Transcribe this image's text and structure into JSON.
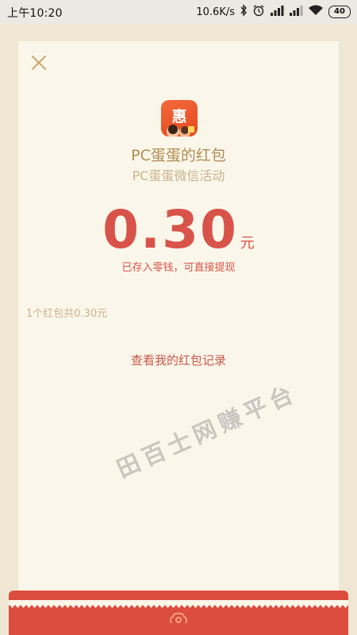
{
  "status_bar": {
    "time": "上午10:20",
    "network_speed": "10.6K/s",
    "battery_level": "40"
  },
  "envelope": {
    "sender_name": "PC蛋蛋的红包",
    "sender_subtitle": "PC蛋蛋微信活动",
    "amount": "0.30",
    "amount_unit": "元",
    "saved_note": "已存入零钱，可直接提现",
    "summary": "1个红包共0.30元",
    "records_link": "查看我的红包记录",
    "app_icon_glyph": "惠"
  },
  "watermark": {
    "text": "田百士网赚平台"
  },
  "colors": {
    "page_background": "#efe6d4",
    "card_background": "#fbf6ea",
    "accent_red": "#d8534a",
    "gold_text": "#b08d53",
    "muted_gold": "#c8b48c",
    "flap_red": "#dc4d3f"
  },
  "icons": {
    "close": "close-icon",
    "bluetooth": "bluetooth-icon",
    "alarm": "alarm-icon",
    "signal": "signal-icon",
    "wifi": "wifi-icon",
    "battery": "battery-icon",
    "flap_logo": "cloud-logo-icon"
  }
}
